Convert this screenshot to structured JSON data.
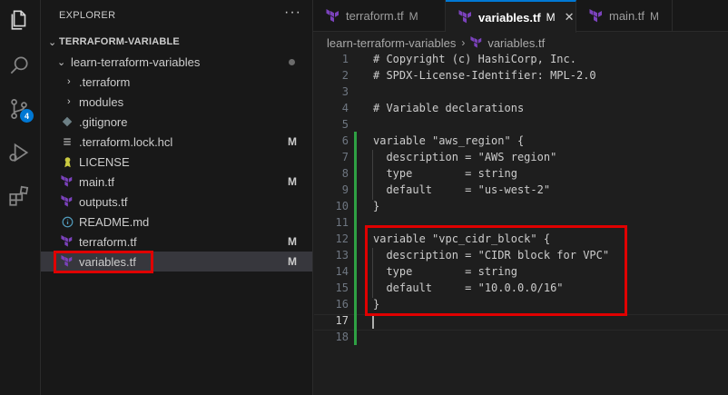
{
  "sidebar": {
    "title": "EXPLORER",
    "more": "···",
    "root": "TERRAFORM-VARIABLE",
    "folder": "learn-terraform-variables",
    "items": [
      {
        "label": ".terraform",
        "kind": "folder",
        "mod": ""
      },
      {
        "label": "modules",
        "kind": "folder",
        "mod": ""
      },
      {
        "label": ".gitignore",
        "kind": "gitignore",
        "mod": ""
      },
      {
        "label": ".terraform.lock.hcl",
        "kind": "lock",
        "mod": "M"
      },
      {
        "label": "LICENSE",
        "kind": "license",
        "mod": ""
      },
      {
        "label": "main.tf",
        "kind": "terraform",
        "mod": "M"
      },
      {
        "label": "outputs.tf",
        "kind": "terraform",
        "mod": ""
      },
      {
        "label": "README.md",
        "kind": "info",
        "mod": ""
      },
      {
        "label": "terraform.tf",
        "kind": "terraform",
        "mod": "M"
      },
      {
        "label": "variables.tf",
        "kind": "terraform",
        "mod": "M"
      }
    ]
  },
  "activity": {
    "scm_badge": "4"
  },
  "tabs": [
    {
      "label": "terraform.tf",
      "mod": "M"
    },
    {
      "label": "variables.tf",
      "mod": "M",
      "close": "✕"
    },
    {
      "label": "main.tf",
      "mod": "M"
    }
  ],
  "breadcrumb": {
    "folder": "learn-terraform-variables",
    "sep": "›",
    "file": "variables.tf"
  },
  "code": {
    "lines": [
      {
        "n": "1",
        "t": "# Copyright (c) HashiCorp, Inc."
      },
      {
        "n": "2",
        "t": "# SPDX-License-Identifier: MPL-2.0"
      },
      {
        "n": "3",
        "t": ""
      },
      {
        "n": "4",
        "t": "# Variable declarations"
      },
      {
        "n": "5",
        "t": ""
      },
      {
        "n": "6",
        "t": "variable \"aws_region\" {"
      },
      {
        "n": "7",
        "t": "  description = \"AWS region\""
      },
      {
        "n": "8",
        "t": "  type        = string"
      },
      {
        "n": "9",
        "t": "  default     = \"us-west-2\""
      },
      {
        "n": "10",
        "t": "}"
      },
      {
        "n": "11",
        "t": ""
      },
      {
        "n": "12",
        "t": "variable \"vpc_cidr_block\" {"
      },
      {
        "n": "13",
        "t": "  description = \"CIDR block for VPC\""
      },
      {
        "n": "14",
        "t": "  type        = string"
      },
      {
        "n": "15",
        "t": "  default     = \"10.0.0.0/16\""
      },
      {
        "n": "16",
        "t": "}"
      },
      {
        "n": "17",
        "t": ""
      },
      {
        "n": "18",
        "t": ""
      }
    ]
  },
  "colors": {
    "accent": "#0078d4",
    "terraform": "#7b42bc",
    "highlight": "#e00000",
    "git_added": "#2ea043"
  }
}
